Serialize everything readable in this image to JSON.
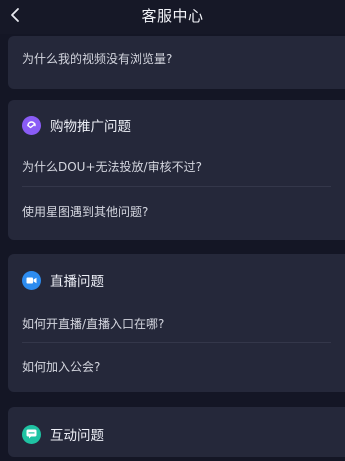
{
  "header": {
    "title": "客服中心",
    "back_icon": "chevron-left-icon"
  },
  "top_card": {
    "question": "为什么我的视频没有浏览量?"
  },
  "sections": [
    {
      "title": "购物推广问题",
      "icon": "shopping-promotion-icon",
      "icon_color": "#8a5cf6",
      "questions": [
        "为什么DOU+无法投放/审核不过?",
        "使用星图遇到其他问题?"
      ]
    },
    {
      "title": "直播问题",
      "icon": "live-video-icon",
      "icon_color": "#2d8cf0",
      "questions": [
        "如何开直播/直播入口在哪?",
        "如何加入公会?"
      ]
    },
    {
      "title": "互动问题",
      "icon": "interaction-chat-icon",
      "icon_color": "#1fc3a3",
      "questions": []
    }
  ]
}
